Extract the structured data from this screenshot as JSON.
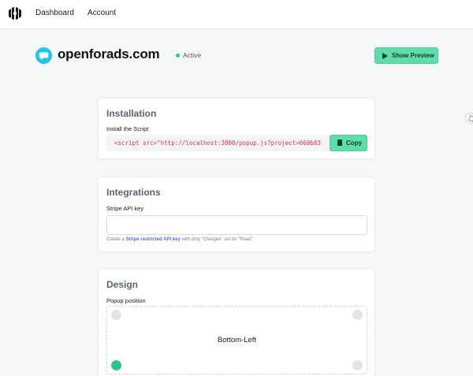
{
  "nav": {
    "logo_icon": "brand-logo-icon",
    "links": [
      "Dashboard",
      "Account"
    ]
  },
  "site": {
    "icon": "chat-bubble-icon",
    "name": "openforads.com",
    "status": "Active",
    "status_color": "#2fc58a",
    "preview_button": "Show Preview"
  },
  "installation": {
    "title": "Installation",
    "label": "Install the Script",
    "script": "<script src=\"http://localhost:3000/popup.js?project=660b83",
    "copy_button": "Copy"
  },
  "integrations": {
    "title": "Integrations",
    "label": "Stripe API key",
    "value": "",
    "placeholder": "",
    "help_prefix": "Create a ",
    "help_link": "Stripe restricted API key",
    "help_suffix": " with only \"Charges\" set on \"Read\"."
  },
  "design": {
    "title": "Design",
    "label": "Popup position",
    "selected_position": "Bottom-Left"
  },
  "colors": {
    "accent": "#5fdcaa",
    "site_icon": "#22c3e4",
    "code": "#d8334a",
    "link": "#4f6bd8"
  }
}
